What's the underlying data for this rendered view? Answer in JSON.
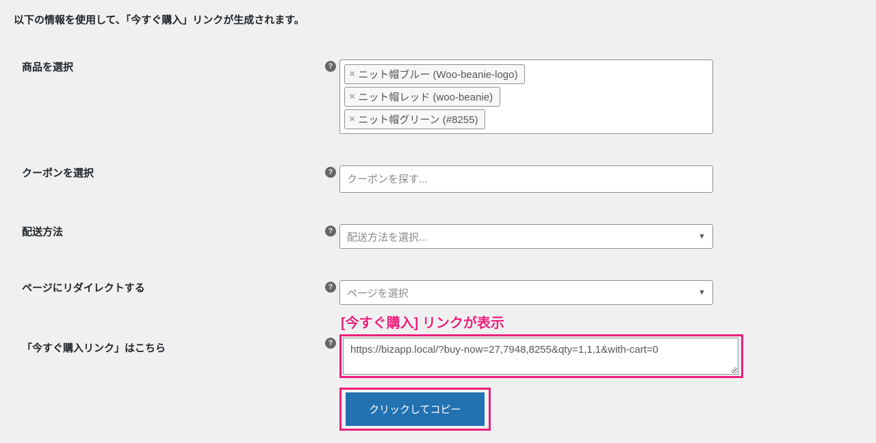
{
  "intro": "以下の情報を使用して、「今すぐ購入」リンクが生成されます。",
  "rows": {
    "products": {
      "label": "商品を選択",
      "tags": [
        "ニット帽ブルー (Woo-beanie-logo)",
        "ニット帽レッド (woo-beanie)",
        "ニット帽グリーン (#8255)"
      ]
    },
    "coupon": {
      "label": "クーポンを選択",
      "placeholder": "クーポンを探す..."
    },
    "shipping": {
      "label": "配送方法",
      "placeholder": "配送方法を選択..."
    },
    "redirect": {
      "label": "ページにリダイレクトする",
      "placeholder": "ページを選択"
    },
    "link": {
      "label": "「今すぐ購入リンク」はこちら",
      "value": "https://bizapp.local/?buy-now=27,7948,8255&qty=1,1,1&with-cart=0"
    }
  },
  "annotation": "[今すぐ購入] リンクが表示",
  "copy_button": "クリックしてコピー"
}
